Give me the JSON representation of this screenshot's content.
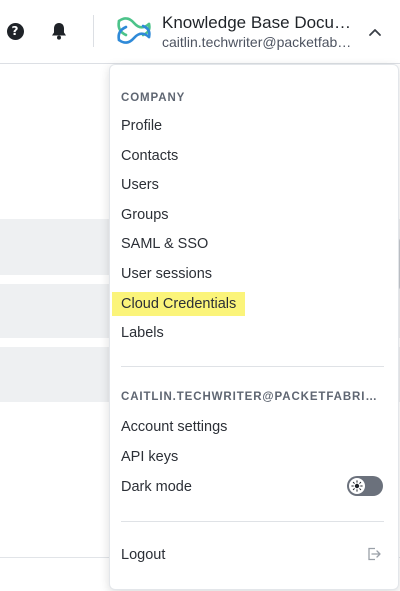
{
  "header": {
    "org_name": "Knowledge Base Documentation",
    "user_email": "caitlin.techwriter@packetfabric.com",
    "icons": [
      "help-icon",
      "bell-icon",
      "logo-icon",
      "chevron-up-icon"
    ]
  },
  "menu": {
    "company_label": "COMPANY",
    "company_items": [
      {
        "label": "Profile"
      },
      {
        "label": "Contacts"
      },
      {
        "label": "Users"
      },
      {
        "label": "Groups"
      },
      {
        "label": "SAML & SSO"
      },
      {
        "label": "User sessions"
      },
      {
        "label": "Cloud Credentials",
        "highlighted": true
      },
      {
        "label": "Labels"
      }
    ],
    "account_label": "CAITLIN.TECHWRITER@PACKETFABRIC.COM",
    "account_items": [
      {
        "label": "Account settings"
      },
      {
        "label": "API keys"
      },
      {
        "label": "Dark mode",
        "toggle": "off"
      }
    ],
    "logout_label": "Logout"
  },
  "colors": {
    "highlight": "#fbf47a",
    "logo_green": "#4cc38a",
    "logo_blue": "#2f8ad8"
  }
}
